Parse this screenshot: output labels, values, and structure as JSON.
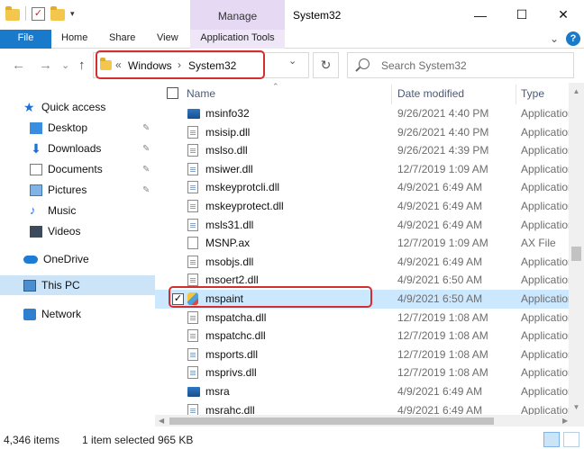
{
  "window": {
    "title": "System32",
    "context_tab": "Manage",
    "controls": {
      "minimize": "—",
      "maximize": "☐",
      "close": "✕"
    }
  },
  "ribbon": {
    "tabs": [
      "File",
      "Home",
      "Share",
      "View",
      "Application Tools"
    ],
    "expand_glyph": "⌄",
    "help_glyph": "?"
  },
  "address": {
    "overflow": "«",
    "crumbs": [
      "Windows",
      "System32"
    ],
    "separator": "›",
    "dropdown_glyph": "⌄",
    "refresh_glyph": "↻",
    "search_placeholder": "Search System32"
  },
  "nav": {
    "back": "←",
    "forward": "→",
    "recent": "⌄",
    "up": "↑",
    "items": [
      {
        "label": "Quick access"
      },
      {
        "label": "Desktop",
        "pinned": true
      },
      {
        "label": "Downloads",
        "pinned": true
      },
      {
        "label": "Documents",
        "pinned": true
      },
      {
        "label": "Pictures",
        "pinned": true
      },
      {
        "label": "Music"
      },
      {
        "label": "Videos"
      },
      {
        "label": "OneDrive"
      },
      {
        "label": "This PC",
        "selected": true
      },
      {
        "label": "Network"
      }
    ],
    "pin_glyph": "📌"
  },
  "columns": {
    "name": "Name",
    "date": "Date modified",
    "type": "Type"
  },
  "files": [
    {
      "name": "msinfo32",
      "date": "9/26/2021 4:40 PM",
      "type": "Application",
      "icon": "exe-icon"
    },
    {
      "name": "msisip.dll",
      "date": "9/26/2021 4:40 PM",
      "type": "Application",
      "icon": "dll-icon"
    },
    {
      "name": "mslso.dll",
      "date": "9/26/2021 4:39 PM",
      "type": "Application",
      "icon": "dll-icon"
    },
    {
      "name": "msiwer.dll",
      "date": "12/7/2019 1:09 AM",
      "type": "Application",
      "icon": "dll-icon"
    },
    {
      "name": "mskeyprotcli.dll",
      "date": "4/9/2021 6:49 AM",
      "type": "Application",
      "icon": "dll-icon"
    },
    {
      "name": "mskeyprotect.dll",
      "date": "4/9/2021 6:49 AM",
      "type": "Application",
      "icon": "dll-icon"
    },
    {
      "name": "msls31.dll",
      "date": "4/9/2021 6:49 AM",
      "type": "Application",
      "icon": "dll-icon"
    },
    {
      "name": "MSNP.ax",
      "date": "12/7/2019 1:09 AM",
      "type": "AX File",
      "icon": "file-icon"
    },
    {
      "name": "msobjs.dll",
      "date": "4/9/2021 6:49 AM",
      "type": "Application",
      "icon": "dll-icon"
    },
    {
      "name": "msoert2.dll",
      "date": "4/9/2021 6:50 AM",
      "type": "Application",
      "icon": "dll-icon"
    },
    {
      "name": "mspaint",
      "date": "4/9/2021 6:50 AM",
      "type": "Application",
      "icon": "paint-icon",
      "selected": true
    },
    {
      "name": "mspatcha.dll",
      "date": "12/7/2019 1:08 AM",
      "type": "Application",
      "icon": "dll-icon"
    },
    {
      "name": "mspatchc.dll",
      "date": "12/7/2019 1:08 AM",
      "type": "Application",
      "icon": "dll-icon"
    },
    {
      "name": "msports.dll",
      "date": "12/7/2019 1:08 AM",
      "type": "Application",
      "icon": "dll-icon"
    },
    {
      "name": "msprivs.dll",
      "date": "12/7/2019 1:08 AM",
      "type": "Application",
      "icon": "dll-icon"
    },
    {
      "name": "msra",
      "date": "4/9/2021 6:49 AM",
      "type": "Application",
      "icon": "exe-icon"
    },
    {
      "name": "msrahc.dll",
      "date": "4/9/2021 6:49 AM",
      "type": "Application",
      "icon": "dll-icon"
    }
  ],
  "status": {
    "item_count": "4,346 items",
    "selection": "1 item selected",
    "size": "965 KB"
  }
}
